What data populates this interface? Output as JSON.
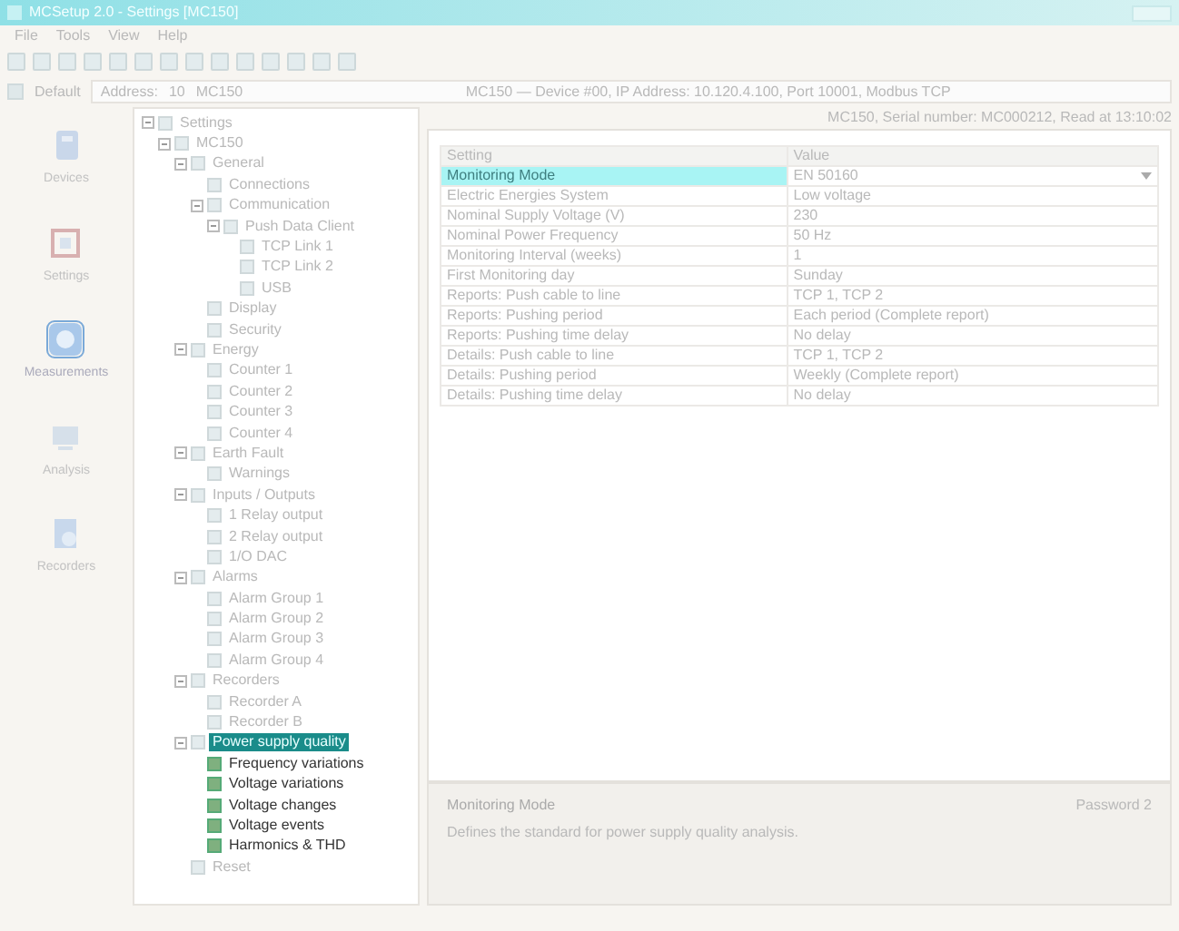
{
  "window": {
    "title": "MCSetup 2.0 - Settings [MC150]"
  },
  "menu": [
    "File",
    "Tools",
    "View",
    "Help"
  ],
  "address_bar": {
    "profile": "Default",
    "label": "Address:",
    "number": "10",
    "device": "MC150",
    "connection": "MC150 — Device #00, IP Address: 10.120.4.100, Port 10001, Modbus TCP"
  },
  "sidebar": {
    "items": [
      {
        "label": "Devices",
        "selected": false
      },
      {
        "label": "Settings",
        "selected": false
      },
      {
        "label": "Measurements",
        "selected": true
      },
      {
        "label": "Analysis",
        "selected": false
      },
      {
        "label": "Recorders",
        "selected": false
      }
    ]
  },
  "tree": {
    "items": [
      {
        "label": "Settings",
        "expanded": true,
        "selected": false,
        "children": [
          {
            "label": "MC150",
            "expanded": true,
            "selected": false,
            "children": [
              {
                "label": "General",
                "expanded": true,
                "selected": false,
                "children": [
                  {
                    "label": "Connections",
                    "selected": false
                  },
                  {
                    "label": "Communication",
                    "expanded": true,
                    "selected": false,
                    "children": [
                      {
                        "label": "Push Data Client",
                        "expanded": true,
                        "selected": false,
                        "children": [
                          {
                            "label": "TCP Link 1",
                            "selected": false
                          },
                          {
                            "label": "TCP Link 2",
                            "selected": false
                          },
                          {
                            "label": "USB",
                            "selected": false
                          }
                        ]
                      }
                    ]
                  },
                  {
                    "label": "Display",
                    "selected": false
                  },
                  {
                    "label": "Security",
                    "selected": false
                  }
                ]
              },
              {
                "label": "Energy",
                "expanded": true,
                "selected": false,
                "children": [
                  {
                    "label": "Counter 1",
                    "selected": false
                  },
                  {
                    "label": "Counter 2",
                    "selected": false
                  },
                  {
                    "label": "Counter 3",
                    "selected": false
                  },
                  {
                    "label": "Counter 4",
                    "selected": false
                  }
                ]
              },
              {
                "label": "Earth Fault",
                "expanded": true,
                "selected": false,
                "children": [
                  {
                    "label": "Warnings",
                    "selected": false
                  }
                ]
              },
              {
                "label": "Inputs / Outputs",
                "expanded": true,
                "selected": false,
                "children": [
                  {
                    "label": "1 Relay output",
                    "selected": false
                  },
                  {
                    "label": "2 Relay output",
                    "selected": false
                  },
                  {
                    "label": "1/O DAC",
                    "selected": false
                  }
                ]
              },
              {
                "label": "Alarms",
                "expanded": true,
                "selected": false,
                "children": [
                  {
                    "label": "Alarm Group 1",
                    "selected": false
                  },
                  {
                    "label": "Alarm Group 2",
                    "selected": false
                  },
                  {
                    "label": "Alarm Group 3",
                    "selected": false
                  },
                  {
                    "label": "Alarm Group 4",
                    "selected": false
                  }
                ]
              },
              {
                "label": "Recorders",
                "expanded": true,
                "selected": false,
                "children": [
                  {
                    "label": "Recorder A",
                    "selected": false
                  },
                  {
                    "label": "Recorder B",
                    "selected": false
                  }
                ]
              },
              {
                "label": "Power supply quality",
                "expanded": true,
                "selected": true,
                "children": [
                  {
                    "label": "Frequency variations",
                    "selected": false
                  },
                  {
                    "label": "Voltage variations",
                    "selected": false
                  },
                  {
                    "label": "Voltage changes",
                    "selected": false
                  },
                  {
                    "label": "Voltage events",
                    "selected": false
                  },
                  {
                    "label": "Harmonics & THD",
                    "selected": false
                  }
                ]
              },
              {
                "label": "Reset",
                "selected": false
              }
            ]
          }
        ]
      }
    ]
  },
  "info": "MC150, Serial number: MC000212, Read at 13:10:02",
  "table": {
    "columns": [
      "Setting",
      "Value"
    ],
    "rows": [
      {
        "setting": "Monitoring Mode",
        "value": "EN 50160",
        "selected": true
      },
      {
        "setting": "Electric Energies System",
        "value": "Low voltage",
        "selected": false
      },
      {
        "setting": "Nominal Supply Voltage (V)",
        "value": "230",
        "selected": false
      },
      {
        "setting": "Nominal Power Frequency",
        "value": "50 Hz",
        "selected": false
      },
      {
        "setting": "Monitoring Interval (weeks)",
        "value": "1",
        "selected": false
      },
      {
        "setting": "First Monitoring day",
        "value": "Sunday",
        "selected": false
      },
      {
        "setting": "Reports: Push cable to line",
        "value": "TCP 1, TCP 2",
        "selected": false
      },
      {
        "setting": "Reports: Pushing period",
        "value": "Each period (Complete report)",
        "selected": false
      },
      {
        "setting": "Reports: Pushing time delay",
        "value": "No delay",
        "selected": false
      },
      {
        "setting": "Details: Push cable to line",
        "value": "TCP 1, TCP 2",
        "selected": false
      },
      {
        "setting": "Details: Pushing period",
        "value": "Weekly (Complete report)",
        "selected": false
      },
      {
        "setting": "Details: Pushing time delay",
        "value": "No delay",
        "selected": false
      }
    ]
  },
  "description": {
    "title": "Monitoring Mode",
    "text": "Defines the standard for power supply quality analysis.",
    "access": "Password 2"
  }
}
